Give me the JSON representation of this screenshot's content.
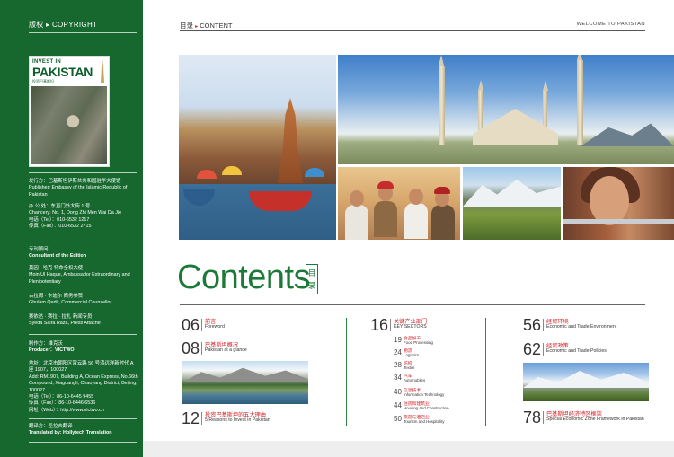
{
  "sidebar": {
    "copyright": "版权 ▸ COPYRIGHT",
    "cover": {
      "invest": "INVEST IN",
      "title": "PAKISTAN",
      "subtitle": "投资巴基斯坦"
    },
    "publisher_cn": "发行方：巴基斯坦伊斯兰共和国驻华大使馆",
    "publisher_en": "Publisher: Embassy of the Islamic Republic of Pakistan",
    "address_cn": "办 公 处：东直门外大街 1 号",
    "address_en": "Chancery: No. 1, Dong Zhi Men Wai Da Jie",
    "tel": "电话（Tel）：010-6532 1217",
    "fax": "传真（Fax）：010-6532 2715",
    "consultant_cn": "专刊顾问",
    "consultant_en": "Consultant of the Edition",
    "amb_cn": "莫因 · 哈克  特命全权大使",
    "amb_en": "Moin Ul Haque, Ambassador Extraordinary and Plenipotentiary",
    "counsel_cn": "古拉姆 · 卡迪尔  商务参赞",
    "counsel_en": "Ghulam Qadir, Commercial Counsellor",
    "press_cn": "赛依达 · 赛拉 · 拉扎  新闻专员",
    "press_en": "Syeda Saira Raza, Press Attache",
    "producer_cn": "制作方：维克沃",
    "producer_en": "Producer：VICTWO",
    "addr2_cn": "地址：北京市朝阳区霄云路 56 号鸿远洋新时代 A 座 1907，100027",
    "addr2_en": "Add: RM1907, Building A, Ocean Express, No.66th Compound, Xiaguangli, Chaoyang District, Beijing, 100027",
    "tel2": "电话（Tel）：86-10-6445 9455",
    "fax2": "传真（Fax）：86-10-6446 6536",
    "web": "网址（Web）：http://www.victwo.cn",
    "translation_cn": "翻译方：圣拉夫翻译",
    "translation_en": "Translated by: Hollytech Translation"
  },
  "header": {
    "section_cn": "目录",
    "section_arrow": "▸",
    "section_en": "CONTENT",
    "welcome": "WELCOME TO PAKISTAN"
  },
  "contents": {
    "title": "Contents",
    "mulu_1": "目",
    "mulu_2": "录"
  },
  "toc": [
    {
      "num": "06",
      "cn": "前言",
      "en": "Foreword"
    },
    {
      "num": "08",
      "cn": "巴基斯坦概况",
      "en": "Pakistan at a glance"
    },
    {
      "num": "12",
      "cn": "投资巴基斯坦的五大理由",
      "en": "5 Reasons to Invest in Pakistan"
    },
    {
      "num": "16",
      "cn": "关键产业部门",
      "en": "KEY SECTORS"
    },
    {
      "num": "56",
      "cn": "经贸环境",
      "en": "Economic and Trade Environment"
    },
    {
      "num": "62",
      "cn": "经贸政策",
      "en": "Economic and Trade Policies"
    },
    {
      "num": "78",
      "cn": "巴基斯坦经济特区框架",
      "en": "Special Economic Zone Framework in Pakistan"
    }
  ],
  "sectors": [
    {
      "num": "19",
      "cn": "食品加工",
      "en": "Food Processing"
    },
    {
      "num": "24",
      "cn": "物流",
      "en": "Logistics"
    },
    {
      "num": "28",
      "cn": "纺织",
      "en": "Textile"
    },
    {
      "num": "34",
      "cn": "汽车",
      "en": "Automobiles"
    },
    {
      "num": "40",
      "cn": "信息技术",
      "en": "Information Technology"
    },
    {
      "num": "44",
      "cn": "住房和建筑业",
      "en": "Housing and Construction"
    },
    {
      "num": "50",
      "cn": "旅游与酒店业",
      "en": "Tourism and Hospitality"
    }
  ],
  "colors": {
    "green": "#17682e",
    "accent_red": "#d32027"
  }
}
